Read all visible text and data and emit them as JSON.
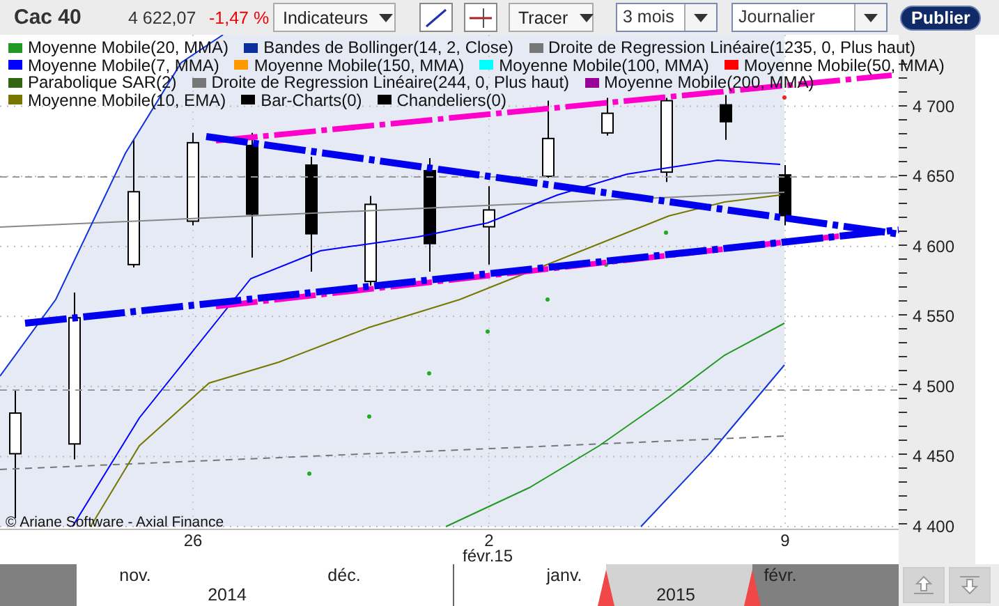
{
  "toolbar": {
    "instrument": "Cac 40",
    "price": "4 622,07",
    "change": "-1,47 %",
    "indicators_menu": "Indicateurs",
    "draw_menu": "Tracer",
    "period": "3 mois",
    "interval": "Journalier",
    "publish_button": "Publier"
  },
  "legend": [
    [
      {
        "label": "Moyenne Mobile(20, MMA)",
        "color": "#229922"
      },
      {
        "label": "Bandes de Bollinger(14, 2, Close)",
        "color": "#0a2f9a"
      },
      {
        "label": "Droite de Regression Linéaire(1235, 0, Plus haut)",
        "color": "#777777"
      }
    ],
    [
      {
        "label": "Moyenne Mobile(7, MMA)",
        "color": "#0000ff"
      },
      {
        "label": "Moyenne Mobile(150, MMA)",
        "color": "#ff9900"
      },
      {
        "label": "Moyenne Mobile(100, MMA)",
        "color": "#00ffff"
      },
      {
        "label": "Moyenne Mobile(50, MMA)",
        "color": "#ff0000"
      }
    ],
    [
      {
        "label": "Parabolique SAR(2)",
        "color": "#336611"
      },
      {
        "label": "Droite de Regression Linéaire(244, 0, Plus haut)",
        "color": "#777777"
      },
      {
        "label": "Moyenne Mobile(200, MMA)",
        "color": "#990099"
      }
    ],
    [
      {
        "label": "Moyenne Mobile(10, EMA)",
        "color": "#777700"
      },
      {
        "label": "Bar-Charts(0)",
        "color": "#000000"
      },
      {
        "label": "Chandeliers(0)",
        "color": "#000000"
      }
    ]
  ],
  "chart": {
    "chart_data": {
      "type": "candlestick",
      "categories": [
        null,
        null,
        null,
        "26",
        null,
        null,
        null,
        null,
        "2",
        null,
        null,
        null,
        null,
        "9"
      ],
      "ylim": [
        4398,
        4751
      ],
      "grid": true,
      "ohlc": [
        [
          4452,
          4497,
          4406,
          4481
        ],
        [
          4459,
          4567,
          4448,
          4549
        ],
        [
          4587,
          4676,
          4585,
          4639
        ],
        [
          4618,
          4681,
          4615,
          4674
        ],
        [
          4672,
          4681,
          4592,
          4623
        ],
        [
          4658,
          4664,
          4582,
          4609
        ],
        [
          4575,
          4636,
          4572,
          4630
        ],
        [
          4654,
          4663,
          4582,
          4602
        ],
        [
          4614,
          4643,
          4587,
          4626
        ],
        [
          4650,
          4704,
          4649,
          4677
        ],
        [
          4681,
          4706,
          4679,
          4695
        ],
        [
          4653,
          4706,
          4646,
          4704
        ],
        [
          4701,
          4708,
          4676,
          4689
        ],
        [
          4651,
          4658,
          4615,
          4622
        ]
      ],
      "yticks": [
        {
          "value": 4700,
          "label": "4 700"
        },
        {
          "value": 4650,
          "label": "4 650"
        },
        {
          "value": 4600,
          "label": "4 600"
        },
        {
          "value": 4550,
          "label": "4 550"
        },
        {
          "value": 4500,
          "label": "4 500"
        },
        {
          "value": 4450,
          "label": "4 450"
        },
        {
          "value": 4400,
          "label": "4 400"
        }
      ],
      "xlabel": "févr.15"
    },
    "copyright": "© Ariane Software - Axial Finance"
  },
  "navigator": {
    "months": [
      "nov.",
      "déc.",
      "janv.",
      "févr."
    ],
    "years": [
      "2014",
      "2015"
    ]
  }
}
